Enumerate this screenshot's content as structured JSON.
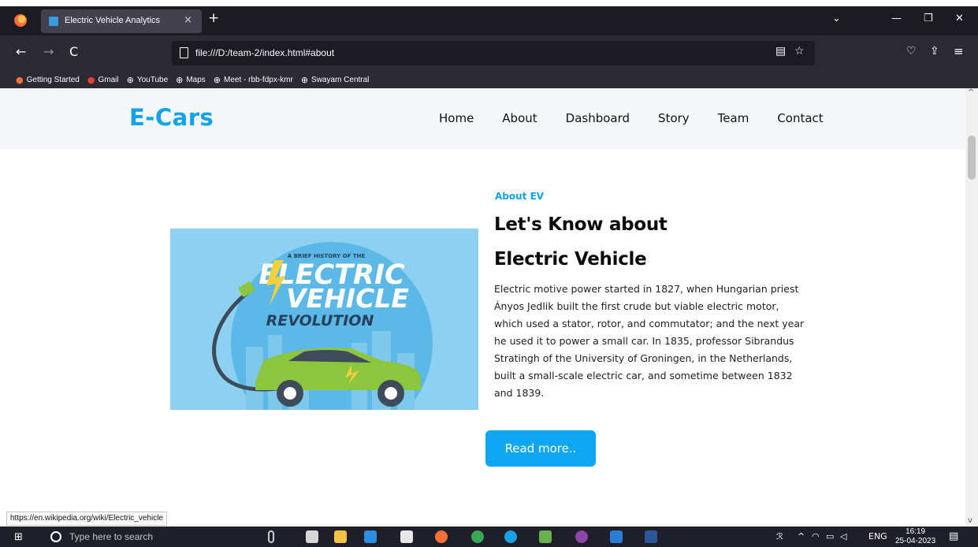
{
  "browser": {
    "tab_title": "Electric Vehicle Analytics",
    "tab_close": "×",
    "new_tab": "+",
    "url": "file:///D:/team-2/index.html#about",
    "back": "←",
    "forward": "→",
    "reload": "C",
    "menu_chevron": "⌄",
    "minimize": "—",
    "restore": "❐",
    "close": "✕",
    "reader_icon": "▤",
    "star_icon": "☆",
    "pocket_icon": "♡",
    "share_icon": "⇪",
    "hamburger_icon": "≡",
    "bookmarks": [
      {
        "label": "Getting Started",
        "icon": "firefox-icon"
      },
      {
        "label": "Gmail",
        "icon": "google-icon"
      },
      {
        "label": "YouTube",
        "icon": "globe-icon"
      },
      {
        "label": "Maps",
        "icon": "globe-icon"
      },
      {
        "label": "Meet - rbb-fdpx-kmr",
        "icon": "globe-icon"
      },
      {
        "label": "Swayam Central",
        "icon": "globe-icon"
      }
    ]
  },
  "site": {
    "logo": "E-Cars",
    "menu": [
      "Home",
      "About",
      "Dashboard",
      "Story",
      "Team",
      "Contact"
    ],
    "about": {
      "eyebrow": "About EV",
      "heading_line1": "Let's Know about",
      "heading_line2": "Electric Vehicle",
      "body": "Electric motive power started in 1827, when Hungarian priest Ányos Jedlik built the first crude but viable electric motor, which used a stator, rotor, and commutator; and the next year he used it to power a small car. In 1835, professor Sibrandus Stratingh of the University of Groningen, in the Netherlands, built a small-scale electric car, and sometime between 1832 and 1839.",
      "button": "Read more..",
      "image": {
        "small_caption": "A BRIEF HISTORY OF THE",
        "line1": "ELECTRIC",
        "line2": "VEHICLE",
        "line3": "REVOLUTION"
      }
    }
  },
  "status_link": "https://en.wikipedia.org/wiki/Electric_vehicle",
  "taskbar": {
    "search_placeholder": "Type here to search",
    "lang": "ENG",
    "time": "16:19",
    "date": "25-04-2023"
  },
  "colors": {
    "accent": "#11a3e8",
    "button": "#0ea5f2",
    "car": "#8cc63f"
  }
}
